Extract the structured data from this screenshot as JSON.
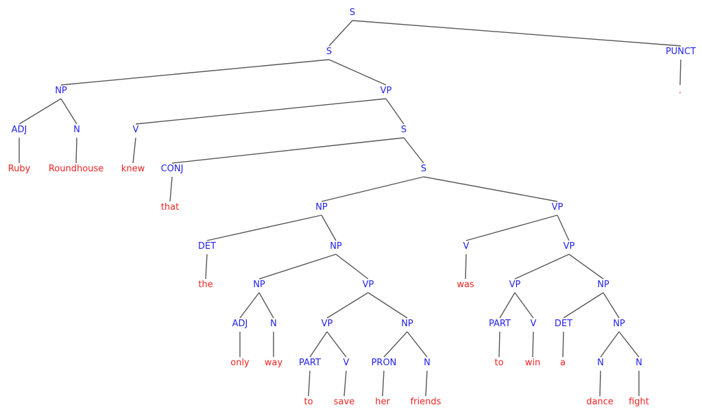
{
  "diagram": {
    "type": "constituency-parse-tree",
    "sentence": "Ruby Roundhouse knew that the only way to save her friends was to win a dance fight .",
    "colors": {
      "nonterminal": "#2222ee",
      "terminal": "#ee2222",
      "edge": "#555555"
    },
    "nodes": [
      {
        "id": "n0",
        "label": "S",
        "kind": "nonterminal",
        "parent": null
      },
      {
        "id": "n1",
        "label": "S",
        "kind": "nonterminal",
        "parent": "n0"
      },
      {
        "id": "n2",
        "label": "PUNCT",
        "kind": "nonterminal",
        "parent": "n0"
      },
      {
        "id": "n3",
        "label": ".",
        "kind": "terminal",
        "parent": "n2"
      },
      {
        "id": "n4",
        "label": "NP",
        "kind": "nonterminal",
        "parent": "n1"
      },
      {
        "id": "n5",
        "label": "VP",
        "kind": "nonterminal",
        "parent": "n1"
      },
      {
        "id": "n6",
        "label": "ADJ",
        "kind": "nonterminal",
        "parent": "n4"
      },
      {
        "id": "n7",
        "label": "N",
        "kind": "nonterminal",
        "parent": "n4"
      },
      {
        "id": "n8",
        "label": "Ruby",
        "kind": "terminal",
        "parent": "n6"
      },
      {
        "id": "n9",
        "label": "Roundhouse",
        "kind": "terminal",
        "parent": "n7"
      },
      {
        "id": "n10",
        "label": "V",
        "kind": "nonterminal",
        "parent": "n5"
      },
      {
        "id": "n11",
        "label": "S",
        "kind": "nonterminal",
        "parent": "n5"
      },
      {
        "id": "n12",
        "label": "knew",
        "kind": "terminal",
        "parent": "n10"
      },
      {
        "id": "n13",
        "label": "CONJ",
        "kind": "nonterminal",
        "parent": "n11"
      },
      {
        "id": "n14",
        "label": "S",
        "kind": "nonterminal",
        "parent": "n11"
      },
      {
        "id": "n15",
        "label": "that",
        "kind": "terminal",
        "parent": "n13"
      },
      {
        "id": "n16",
        "label": "NP",
        "kind": "nonterminal",
        "parent": "n14"
      },
      {
        "id": "n17",
        "label": "VP",
        "kind": "nonterminal",
        "parent": "n14"
      },
      {
        "id": "n18",
        "label": "DET",
        "kind": "nonterminal",
        "parent": "n16"
      },
      {
        "id": "n19",
        "label": "NP",
        "kind": "nonterminal",
        "parent": "n16"
      },
      {
        "id": "n20",
        "label": "the",
        "kind": "terminal",
        "parent": "n18"
      },
      {
        "id": "n21",
        "label": "NP",
        "kind": "nonterminal",
        "parent": "n19"
      },
      {
        "id": "n22",
        "label": "VP",
        "kind": "nonterminal",
        "parent": "n19"
      },
      {
        "id": "n23",
        "label": "ADJ",
        "kind": "nonterminal",
        "parent": "n21"
      },
      {
        "id": "n24",
        "label": "N",
        "kind": "nonterminal",
        "parent": "n21"
      },
      {
        "id": "n25",
        "label": "only",
        "kind": "terminal",
        "parent": "n23"
      },
      {
        "id": "n26",
        "label": "way",
        "kind": "terminal",
        "parent": "n24"
      },
      {
        "id": "n27",
        "label": "VP",
        "kind": "nonterminal",
        "parent": "n22"
      },
      {
        "id": "n28",
        "label": "NP",
        "kind": "nonterminal",
        "parent": "n22"
      },
      {
        "id": "n29",
        "label": "PART",
        "kind": "nonterminal",
        "parent": "n27"
      },
      {
        "id": "n30",
        "label": "V",
        "kind": "nonterminal",
        "parent": "n27"
      },
      {
        "id": "n31",
        "label": "to",
        "kind": "terminal",
        "parent": "n29"
      },
      {
        "id": "n32",
        "label": "save",
        "kind": "terminal",
        "parent": "n30"
      },
      {
        "id": "n33",
        "label": "PRON",
        "kind": "nonterminal",
        "parent": "n28"
      },
      {
        "id": "n34",
        "label": "N",
        "kind": "nonterminal",
        "parent": "n28"
      },
      {
        "id": "n35",
        "label": "her",
        "kind": "terminal",
        "parent": "n33"
      },
      {
        "id": "n36",
        "label": "friends",
        "kind": "terminal",
        "parent": "n34"
      },
      {
        "id": "n37",
        "label": "V",
        "kind": "nonterminal",
        "parent": "n17"
      },
      {
        "id": "n38",
        "label": "VP",
        "kind": "nonterminal",
        "parent": "n17"
      },
      {
        "id": "n39",
        "label": "was",
        "kind": "terminal",
        "parent": "n37"
      },
      {
        "id": "n40",
        "label": "VP",
        "kind": "nonterminal",
        "parent": "n38"
      },
      {
        "id": "n41",
        "label": "NP",
        "kind": "nonterminal",
        "parent": "n38"
      },
      {
        "id": "n42",
        "label": "PART",
        "kind": "nonterminal",
        "parent": "n40"
      },
      {
        "id": "n43",
        "label": "V",
        "kind": "nonterminal",
        "parent": "n40"
      },
      {
        "id": "n44",
        "label": "to",
        "kind": "terminal",
        "parent": "n42"
      },
      {
        "id": "n45",
        "label": "win",
        "kind": "terminal",
        "parent": "n43"
      },
      {
        "id": "n46",
        "label": "DET",
        "kind": "nonterminal",
        "parent": "n41"
      },
      {
        "id": "n47",
        "label": "NP",
        "kind": "nonterminal",
        "parent": "n41"
      },
      {
        "id": "n48",
        "label": "a",
        "kind": "terminal",
        "parent": "n46"
      },
      {
        "id": "n49",
        "label": "N",
        "kind": "nonterminal",
        "parent": "n47"
      },
      {
        "id": "n50",
        "label": "N",
        "kind": "nonterminal",
        "parent": "n47"
      },
      {
        "id": "n51",
        "label": "dance",
        "kind": "terminal",
        "parent": "n49"
      },
      {
        "id": "n52",
        "label": "fight",
        "kind": "terminal",
        "parent": "n50"
      }
    ]
  }
}
